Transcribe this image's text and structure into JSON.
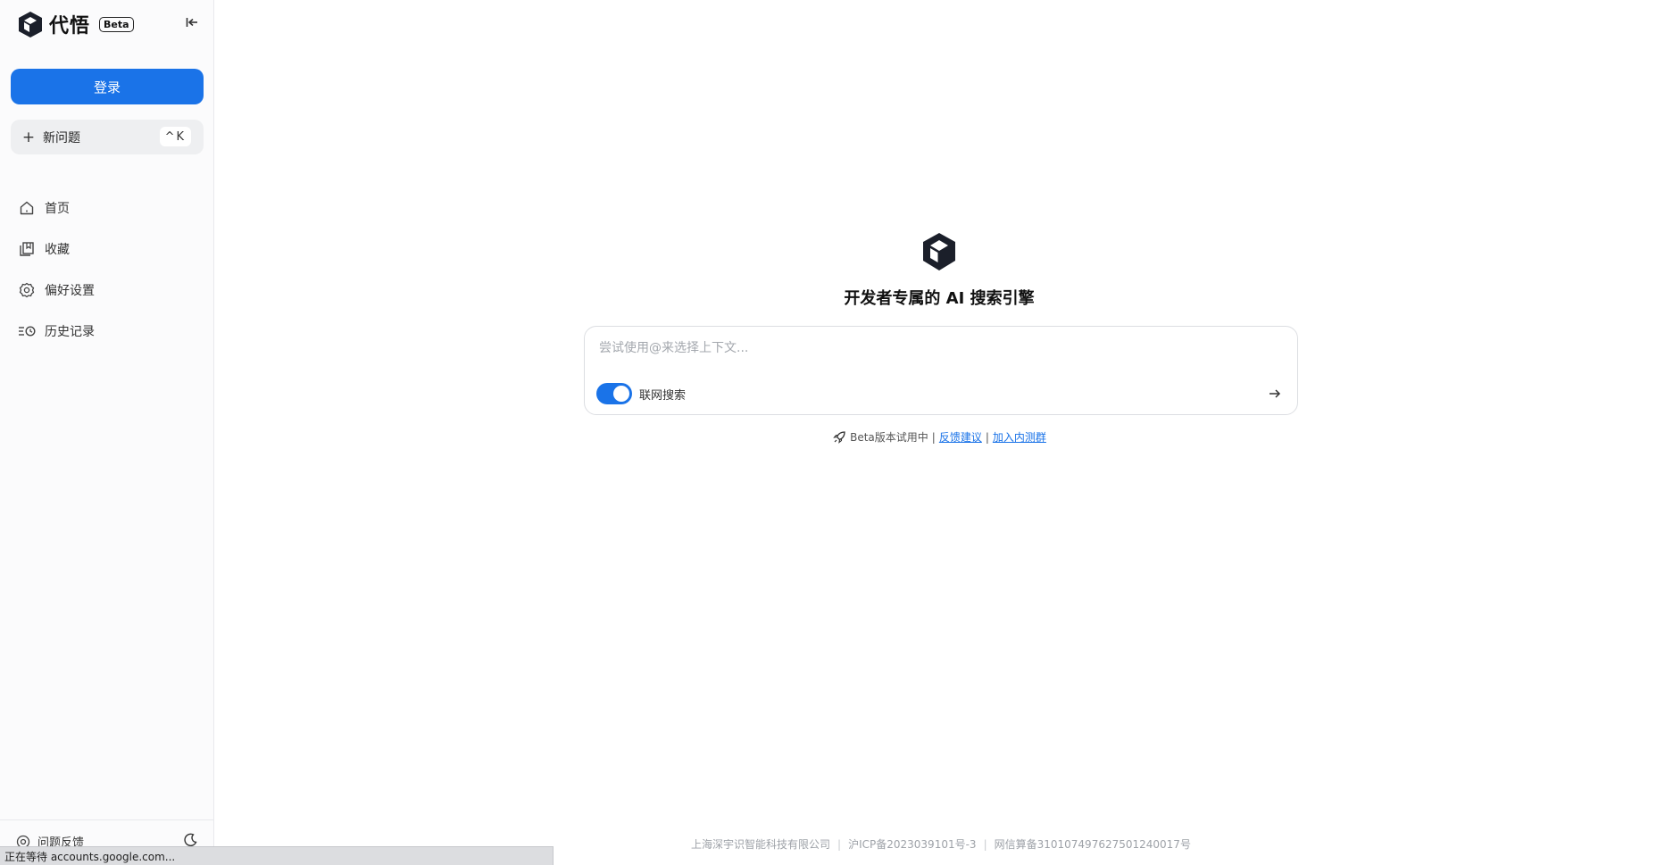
{
  "brand": {
    "name": "代悟",
    "badge": "Beta"
  },
  "sidebar": {
    "login_label": "登录",
    "new_question": {
      "label": "新问题",
      "shortcut": "^K"
    },
    "items": [
      {
        "label": "首页",
        "icon": "home-icon"
      },
      {
        "label": "收藏",
        "icon": "bookmark-icon"
      },
      {
        "label": "偏好设置",
        "icon": "gear-icon"
      },
      {
        "label": "历史记录",
        "icon": "history-icon"
      }
    ],
    "feedback_label": "问题反馈"
  },
  "main": {
    "title": "开发者专属的 AI 搜索引擎",
    "search": {
      "placeholder": "尝试使用@来选择上下文...",
      "value": "",
      "web_search_label": "联网搜索",
      "web_search_enabled": true
    },
    "beta_note": {
      "text": "Beta版本试用中",
      "separator": "|",
      "feedback_link": "反馈建议",
      "join_link": "加入内测群"
    },
    "footer": {
      "company": "上海深宇识智能科技有限公司",
      "icp": "沪ICP备2023039101号-3",
      "registration": "网信算备310107497627501240017号"
    }
  },
  "statusbar": {
    "text": "正在等待 accounts.google.com..."
  },
  "colors": {
    "accent": "#1a73e8",
    "sidebar_bg": "#fbfbfc",
    "text": "#1f2329"
  }
}
